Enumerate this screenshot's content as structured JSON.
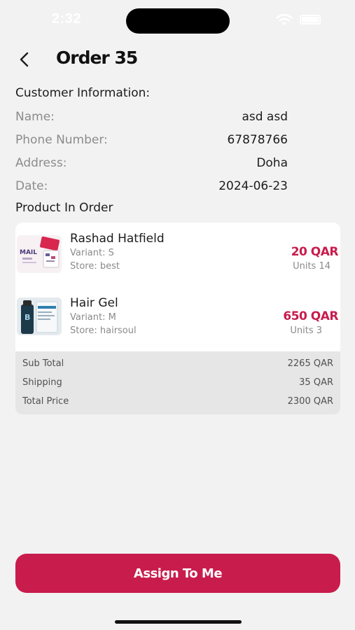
{
  "status_bar": {
    "time": "2:32"
  },
  "header": {
    "title": "Order 35"
  },
  "customer": {
    "section_title": "Customer Information:",
    "name_label": "Name:",
    "name_value": "asd asd",
    "phone_label": "Phone Number:",
    "phone_value": "67878766",
    "address_label": "Address:",
    "address_value": "Doha",
    "date_label": "Date:",
    "date_value": "2024-06-23"
  },
  "products_title": "Product In Order",
  "products": [
    {
      "name": "Rashad Hatfield",
      "variant": "Variant: S",
      "store": "Store: best",
      "price": "20 QAR",
      "units": "Units 14",
      "thumb_text": "MAIL"
    },
    {
      "name": "Hair Gel",
      "variant": "Variant: M",
      "store": "Store: hairsoul",
      "price": "650 QAR",
      "units": "Units 3",
      "thumb_text": "B"
    }
  ],
  "totals": {
    "subtotal_label": "Sub Total",
    "subtotal_value": "2265 QAR",
    "shipping_label": "Shipping",
    "shipping_value": "35 QAR",
    "total_label": "Total Price",
    "total_value": "2300 QAR"
  },
  "actions": {
    "assign_label": "Assign To Me"
  },
  "colors": {
    "accent": "#c81c4c",
    "background": "#f2f2f2"
  },
  "icons": {
    "back": "chevron-left-icon",
    "wifi": "wifi-icon",
    "battery": "battery-icon"
  }
}
